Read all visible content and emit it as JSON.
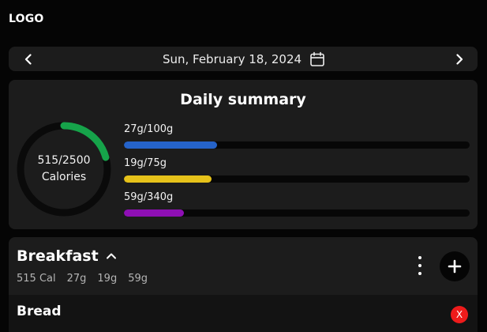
{
  "header": {
    "logo": "LOGO"
  },
  "date_nav": {
    "date_label": "Sun, February 18, 2024",
    "prev_icon": "chevron-left-icon",
    "next_icon": "chevron-right-icon",
    "calendar_icon": "calendar-icon"
  },
  "summary": {
    "title": "Daily summary",
    "calories": {
      "value_text": "515/2500",
      "unit_label": "Calories",
      "consumed": 515,
      "goal": 2500,
      "color": "#16a34a",
      "track_color": "#0a0a0a"
    },
    "macros": [
      {
        "text": "27g/100g",
        "value": 27,
        "goal": 100,
        "color": "#2563c9"
      },
      {
        "text": "19g/75g",
        "value": 19,
        "goal": 75,
        "color": "#e6c21a"
      },
      {
        "text": "59g/340g",
        "value": 59,
        "goal": 340,
        "color": "#8e0fb4"
      }
    ]
  },
  "meals": [
    {
      "name": "Breakfast",
      "stats": [
        "515 Cal",
        "27g",
        "19g",
        "59g"
      ],
      "foods": [
        {
          "name": "Bread",
          "delete_label": "X"
        }
      ],
      "colors": {
        "delete": "#ee1b1b"
      }
    }
  ]
}
